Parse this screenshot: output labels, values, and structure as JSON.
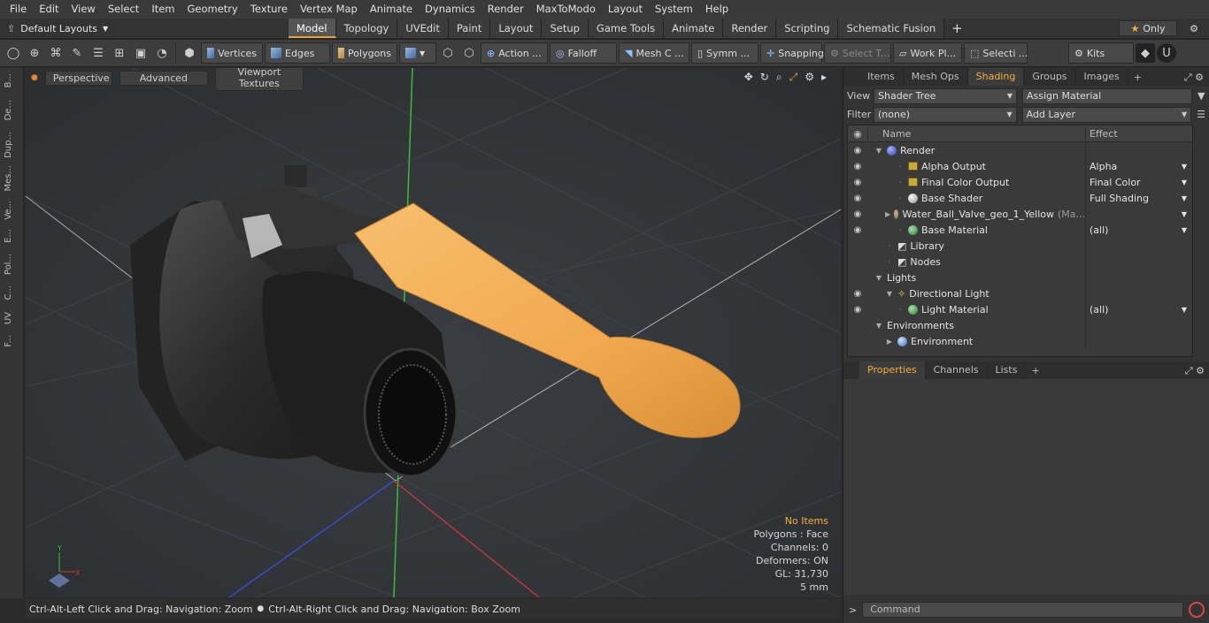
{
  "menu": [
    "File",
    "Edit",
    "View",
    "Select",
    "Item",
    "Geometry",
    "Texture",
    "Vertex Map",
    "Animate",
    "Dynamics",
    "Render",
    "MaxToModo",
    "Layout",
    "System",
    "Help"
  ],
  "layout": {
    "dropdown": "Default Layouts",
    "tabs": [
      "Model",
      "Topology",
      "UVEdit",
      "Paint",
      "Layout",
      "Setup",
      "Game Tools",
      "Animate",
      "Render",
      "Scripting",
      "Schematic Fusion"
    ],
    "active_tab": "Model",
    "only_label": "Only"
  },
  "toolbar": {
    "vertices": "Vertices",
    "edges": "Edges",
    "polygons": "Polygons",
    "action": "Action ...",
    "falloff": "Falloff",
    "meshc": "Mesh C ...",
    "symm": "Symm ...",
    "snapping": "Snapping",
    "selectt": "Select T...",
    "workpl": "Work Pl...",
    "selecti": "Selecti ...",
    "kits": "Kits"
  },
  "leftstrip": [
    "B...",
    "De...",
    "Dup...",
    "Mes...",
    "Ve...",
    "E...",
    "Pol...",
    "C...",
    "UV",
    "F..."
  ],
  "viewport": {
    "perspective": "Perspective",
    "advanced": "Advanced",
    "textures": "Viewport Textures",
    "info": {
      "no_items": "No Items",
      "polygons": "Polygons : Face",
      "channels": "Channels: 0",
      "deformers": "Deformers: ON",
      "gl": "GL: 31,730",
      "scale": "5 mm"
    }
  },
  "status": {
    "left": "Ctrl-Alt-Left Click and Drag: Navigation: Zoom",
    "right": "Ctrl-Alt-Right Click and Drag: Navigation: Box Zoom"
  },
  "panel": {
    "tabs": [
      "Items",
      "Mesh Ops",
      "Shading",
      "Groups",
      "Images"
    ],
    "active_tab": "Shading",
    "view_label": "View",
    "view_value": "Shader Tree",
    "assign_material": "Assign Material",
    "filter_label": "Filter",
    "filter_value": "(none)",
    "add_layer": "Add Layer",
    "col_name": "Name",
    "col_effect": "Effect",
    "rows": [
      {
        "name": "Render",
        "effect": "",
        "eye": true,
        "indent": 0,
        "icon": "render"
      },
      {
        "name": "Alpha Output",
        "effect": "Alpha",
        "eye": true,
        "indent": 2,
        "icon": "output"
      },
      {
        "name": "Final Color Output",
        "effect": "Final Color",
        "eye": true,
        "indent": 2,
        "icon": "output"
      },
      {
        "name": "Base Shader",
        "effect": "Full Shading",
        "eye": true,
        "indent": 2,
        "icon": "shader"
      },
      {
        "name": "Water_Ball_Valve_geo_1_Yellow",
        "suffix": "(Ma...",
        "effect": "",
        "eye": true,
        "indent": 1,
        "icon": "mask"
      },
      {
        "name": "Base Material",
        "effect": "(all)",
        "eye": true,
        "indent": 2,
        "icon": "material"
      },
      {
        "name": "Library",
        "effect": "",
        "eye": false,
        "indent": 1,
        "icon": "folder"
      },
      {
        "name": "Nodes",
        "effect": "",
        "eye": false,
        "indent": 1,
        "icon": "folder"
      },
      {
        "name": "Lights",
        "effect": "",
        "eye": false,
        "indent": 0,
        "icon": "none"
      },
      {
        "name": "Directional Light",
        "effect": "",
        "eye": true,
        "indent": 1,
        "icon": "light"
      },
      {
        "name": "Light Material",
        "effect": "(all)",
        "eye": true,
        "indent": 2,
        "icon": "material"
      },
      {
        "name": "Environments",
        "effect": "",
        "eye": false,
        "indent": 0,
        "icon": "none"
      },
      {
        "name": "Environment",
        "effect": "",
        "eye": false,
        "indent": 1,
        "icon": "env"
      }
    ],
    "props_tabs": [
      "Properties",
      "Channels",
      "Lists"
    ],
    "props_active": "Properties",
    "command_placeholder": "Command"
  },
  "colors": {
    "accent": "#f2b03c",
    "handle": "#f5b15a"
  }
}
